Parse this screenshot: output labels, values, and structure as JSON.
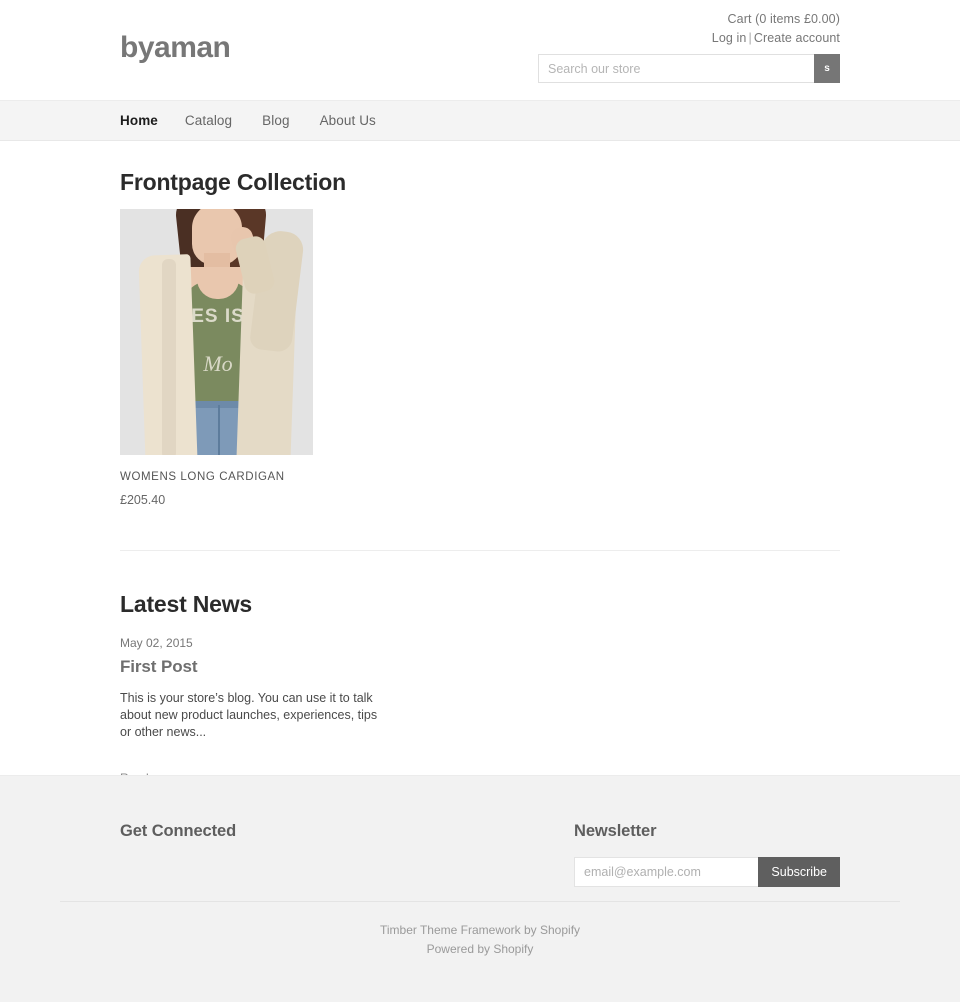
{
  "header": {
    "logo": "byaman",
    "cart": "Cart (0 items £0.00)",
    "login": "Log in",
    "separator": "|",
    "create_account": "Create account",
    "search_placeholder": "Search our store",
    "search_value": "",
    "search_button_label": "s"
  },
  "nav": {
    "items": [
      {
        "label": "Home",
        "active": true
      },
      {
        "label": "Catalog",
        "active": false
      },
      {
        "label": "Blog",
        "active": false
      },
      {
        "label": "About Us",
        "active": false
      }
    ]
  },
  "collection": {
    "title": "Frontpage Collection",
    "products": [
      {
        "title": "WOMENS LONG CARDIGAN",
        "price": "£205.40",
        "image_alt": "Woman wearing a cream long cardigan over a green graphic tee and blue jeans",
        "tee_text": "ES\nIS",
        "tee_script": "Mo"
      }
    ]
  },
  "blog": {
    "title": "Latest News",
    "posts": [
      {
        "date": "May 02, 2015",
        "title": "First Post",
        "excerpt": "This is your store’s blog. You can use it to talk about new product launches, experiences, tips or other news...",
        "read_more": "Read more →"
      }
    ]
  },
  "footer": {
    "get_connected_heading": "Get Connected",
    "newsletter_heading": "Newsletter",
    "newsletter_placeholder": "email@example.com",
    "newsletter_value": "",
    "subscribe_label": "Subscribe",
    "credit_theme": "Timber Theme Framework by Shopify",
    "credit_powered": "Powered by Shopify"
  },
  "colors": {
    "page_bg": "#ffffff",
    "nav_bg": "#f4f4f4",
    "footer_bg": "#f2f2f2",
    "button_dark": "#5f5f5f",
    "search_button": "#767676",
    "text_muted": "#777777",
    "heading": "#2b2b2b"
  }
}
